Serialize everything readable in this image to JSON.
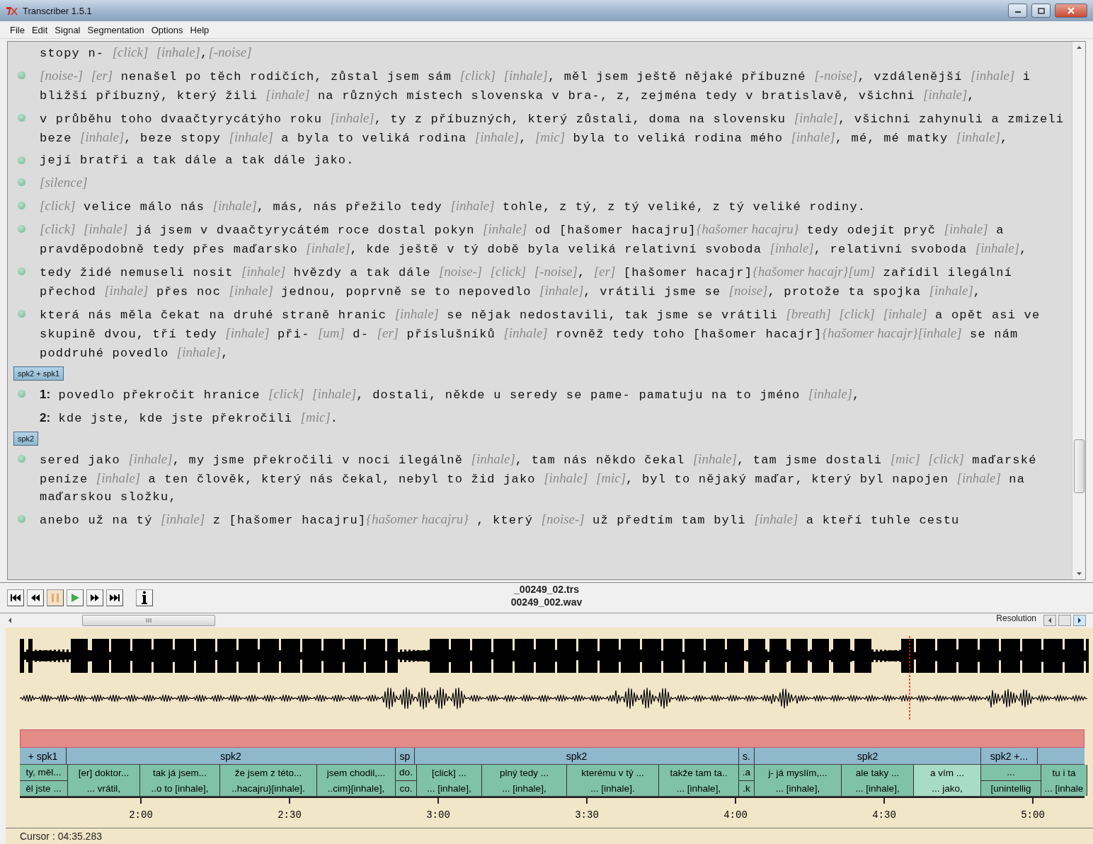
{
  "window": {
    "title": "Transcriber 1.5.1"
  },
  "menu": [
    "File",
    "Edit",
    "Signal",
    "Segmentation",
    "Options",
    "Help"
  ],
  "transcript": [
    {
      "kind": "text",
      "text": "stopy n- *[click]* *[inhale]*,*[-noise]*"
    },
    {
      "kind": "segment",
      "text": "*[noise-]* *[er]* nenašel po těch rodičích, zůstal jsem sám *[click]* *[inhale]*, měl jsem ještě nějaké příbuzné *[-noise]*, vzdálenější *[inhale]* i bližší příbuzný, který žili *[inhale]* na různých místech slovenska v bra-, z, zejména tedy v bratislavě, všichni *[inhale]*,"
    },
    {
      "kind": "segment",
      "text": "v průběhu toho dvaačtyrycátýho roku *[inhale]*, ty z příbuzných, který zůstali, doma na slovensku *[inhale]*, všichni zahynuli a zmizeli beze *[inhale]*, beze stopy *[inhale]* a byla to veliká rodina *[inhale]*, *[mic]* byla to veliká rodina mého *[inhale]*, mé, mé matky *[inhale]*,"
    },
    {
      "kind": "segment",
      "text": "její bratři a tak dále a tak dále jako."
    },
    {
      "kind": "segment",
      "text": "*[silence]*"
    },
    {
      "kind": "segment",
      "text": "*[click]* velice málo nás *[inhale]*, más, nás přežilo tedy *[inhale]* tohle, z tý, z tý veliké, z tý veliké rodiny."
    },
    {
      "kind": "segment",
      "text": "*[click]* *[inhale]* já jsem v dvaačtyrycátém roce dostal pokyn *[inhale]* od [hašomer hacajru]*{hašomer hacajru}* tedy odejít pryč *[inhale]* a pravděpodobně tedy přes maďarsko *[inhale]*, kde ještě v tý době byla veliká relativní svoboda *[inhale]*, relativní svoboda *[inhale]*,"
    },
    {
      "kind": "segment",
      "text": "tedy židé nemuseli nosit *[inhale]* hvězdy a tak dále *[noise-]* *[click]* *[-noise]*, *[er]* [hašomer hacajr]*{hašomer hacajr}[um]* zařídil ilegální přechod *[inhale]* přes noc *[inhale]* jednou, poprvně se to nepovedlo *[inhale]*, vrátili jsme se *[noise]*, protože ta spojka *[inhale]*,"
    },
    {
      "kind": "segment",
      "text": "která nás měla čekat na druhé straně hranic *[inhale]* se nějak nedostavili, tak jsme se vrátili *[breath]* *[click]* *[inhale]* a opět asi ve skupině dvou, tří tedy *[inhale]* při- *[um]* d- *[er]* příslušníků *[inhale]* rovněž tedy toho [hašomer hacajr]*{hašomer hacajr}[inhale]* se nám poddruhé povedlo *[inhale]*,"
    },
    {
      "kind": "speaker",
      "text": "spk2 + spk1"
    },
    {
      "kind": "segment",
      "text": "**1:** povedlo překročit hranice *[click]* *[inhale]*, dostali, někde u seredy se pame- pamatuju na to jméno *[inhale]*,"
    },
    {
      "kind": "text",
      "text": "**2:** kde jste, kde jste překročili *[mic]*."
    },
    {
      "kind": "speaker",
      "text": "spk2"
    },
    {
      "kind": "segment",
      "text": "sered jako *[inhale]*, my jsme překročili v noci ilegálně *[inhale]*, tam nás někdo čekal *[inhale]*, tam jsme dostali *[mic]* *[click]* maďarské peníze *[inhale]* a ten člověk, který nás čekal, nebyl to žid jako *[inhale]* *[mic]*, byl to nějaký maďar, který byl napojen *[inhale]* na maďarskou složku,"
    },
    {
      "kind": "segment",
      "text": "anebo už na tý *[inhale]* z [hašomer hacajru]*{hašomer hacajru}* , který *[noise-]* už předtím tam byli *[inhale]* a kteří tuhle cestu"
    }
  ],
  "player": {
    "transcript_file": "_00249_02.trs",
    "audio_file": "00249_002.wav",
    "resolution_label": "Resolution"
  },
  "timeline": {
    "speakers": [
      {
        "label": "+ spk1"
      },
      {
        "label": "spk2"
      },
      {
        "label": "sp"
      },
      {
        "label": "spk2"
      },
      {
        "label": "s."
      },
      {
        "label": "spk2"
      },
      {
        "label": "spk2 +..."
      }
    ],
    "segments": [
      {
        "kind": "split",
        "lines": [
          "ty, měl...",
          "ěl jste ..."
        ],
        "selected": false
      },
      {
        "kind": "single",
        "lines": [
          "[er] doktor...",
          "... vrátil,"
        ],
        "selected": false
      },
      {
        "kind": "single",
        "lines": [
          "tak já jsem...",
          "..o to [inhale],"
        ],
        "selected": false
      },
      {
        "kind": "single",
        "lines": [
          "že jsem z této...",
          "..hacajru}[inhale]."
        ],
        "selected": false
      },
      {
        "kind": "single",
        "lines": [
          "jsem chodil,...",
          "..cim}[inhale],"
        ],
        "selected": false
      },
      {
        "kind": "split",
        "lines": [
          "do.",
          "co."
        ],
        "selected": false
      },
      {
        "kind": "single",
        "lines": [
          "[click] ...",
          "... [inhale],"
        ],
        "selected": false
      },
      {
        "kind": "single",
        "lines": [
          "plný tedy ...",
          "... [inhale],"
        ],
        "selected": false
      },
      {
        "kind": "single",
        "lines": [
          "kterému v tý ...",
          "... [inhale]."
        ],
        "selected": false
      },
      {
        "kind": "single",
        "lines": [
          "takže tam ta..",
          "... [inhale],"
        ],
        "selected": false
      },
      {
        "kind": "split",
        "lines": [
          ".a",
          ".k"
        ],
        "selected": false
      },
      {
        "kind": "single",
        "lines": [
          "j- já myslím,...",
          "... [inhale],"
        ],
        "selected": false
      },
      {
        "kind": "single",
        "lines": [
          "ale taky ...",
          "... [inhale],"
        ],
        "selected": false
      },
      {
        "kind": "single",
        "lines": [
          "a vím ...",
          "... jako,"
        ],
        "selected": true
      },
      {
        "kind": "split",
        "lines": [
          "...",
          "[unintellig"
        ],
        "selected": false
      },
      {
        "kind": "single",
        "lines": [
          "tu i ta",
          "... [inhale"
        ],
        "selected": false
      }
    ],
    "ticks": [
      "2:00",
      "2:30",
      "3:00",
      "3:30",
      "4:00",
      "4:30",
      "5:00"
    ]
  },
  "status_bar": "Cursor : 04:35.283"
}
